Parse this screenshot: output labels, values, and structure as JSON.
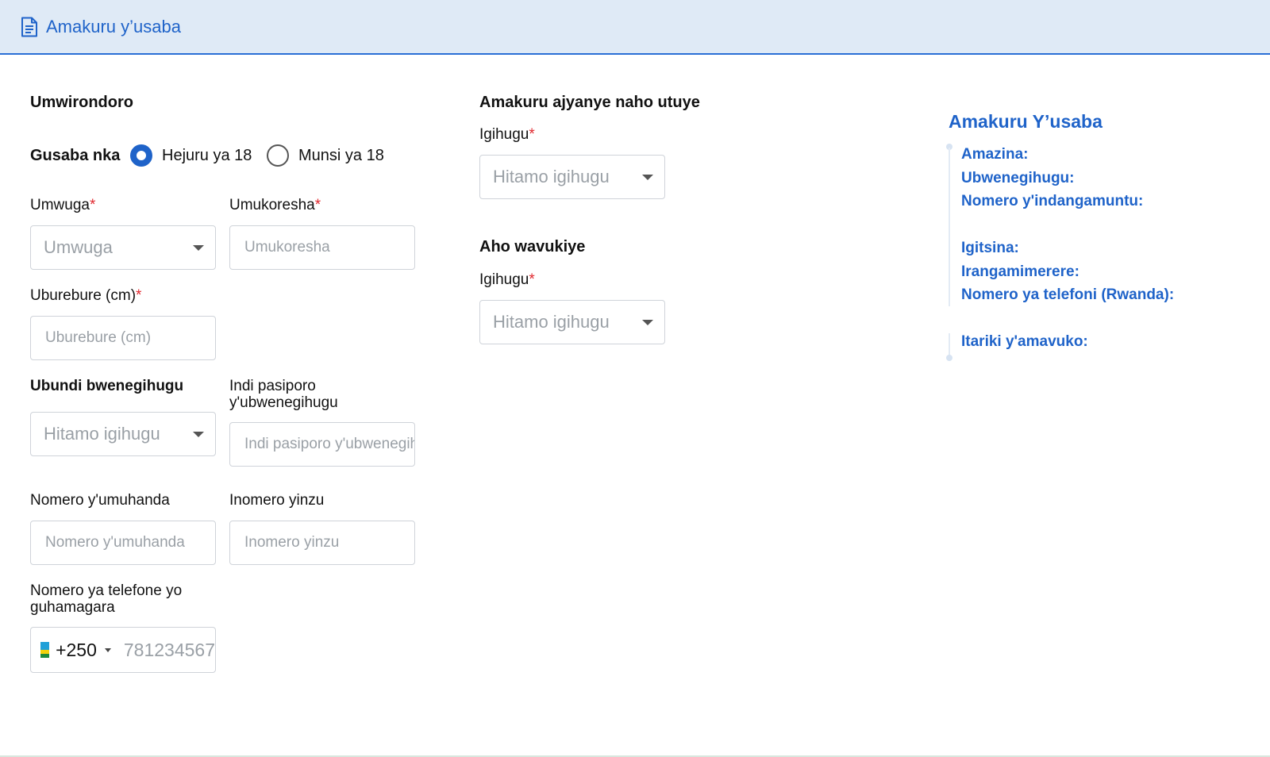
{
  "header": {
    "title": "Amakuru y’usaba",
    "icon": "document-icon"
  },
  "profile": {
    "heading": "Umwirondoro",
    "applies_label": "Gusaba nka",
    "radio_options": [
      {
        "label": "Hejuru ya 18",
        "selected": true
      },
      {
        "label": "Munsi ya 18",
        "selected": false
      }
    ],
    "gender": {
      "label": "Umwuga",
      "placeholder": "Umwuga"
    },
    "employer": {
      "label": "Umukoresha",
      "placeholder": "Umukoresha"
    },
    "height": {
      "label": "Uburebure (cm)",
      "placeholder": "Uburebure (cm)"
    },
    "other_nationality": {
      "label": "Ubundi bwenegihugu",
      "placeholder": "Hitamo igihugu"
    },
    "other_passport": {
      "label": "Indi pasiporo y'ubwenegihugu",
      "placeholder": "Indi pasiporo y'ubwenegihugu"
    },
    "street_number": {
      "label": "Nomero y'umuhanda",
      "placeholder": "Nomero y'umuhanda"
    },
    "house_number": {
      "label": "Inomero yinzu",
      "placeholder": "Inomero yinzu"
    },
    "phone": {
      "label": "Nomero ya telefone yo guhamagara",
      "dial_code": "+250",
      "placeholder": "781234567"
    }
  },
  "residence": {
    "heading": "Amakuru ajyanye naho utuye",
    "country_label": "Igihugu",
    "country_placeholder": "Hitamo igihugu"
  },
  "birthplace": {
    "heading": "Aho wavukiye",
    "country_label": "Igihugu",
    "country_placeholder": "Hitamo igihugu"
  },
  "required_mark": "*",
  "summary": {
    "title": "Amakuru Y’usaba",
    "items": [
      "Amazina:",
      "Ubwenegihugu:",
      "Nomero y'indangamuntu:",
      "Igitsina:",
      "Irangamimerere:",
      "Nomero ya telefoni (Rwanda):",
      "Itariki y'amavuko:"
    ]
  },
  "colors": {
    "accent": "#1f63c9",
    "header_bg": "#dfeaf6",
    "required": "#e0282e",
    "border": "#cfd3d9"
  }
}
